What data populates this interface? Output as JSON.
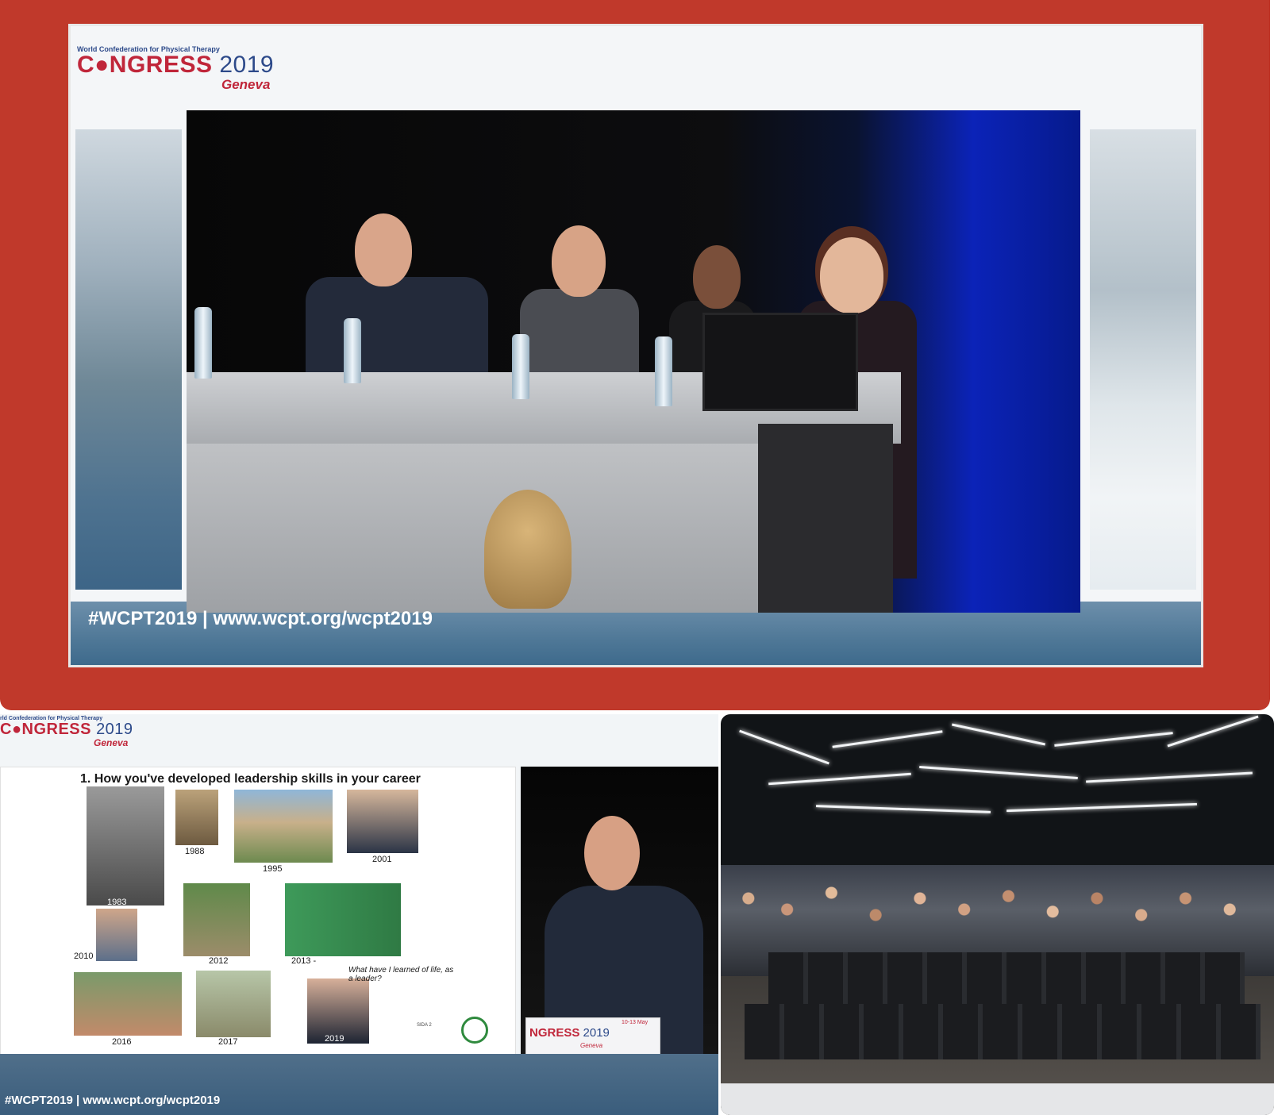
{
  "top_screen": {
    "logo": {
      "org": "World Confederation for Physical Therapy",
      "title": "C●NGRESS",
      "year": "2019",
      "city": "Geneva"
    },
    "hashtag": "#WCPT2019 | www.wcpt.org/wcpt2019"
  },
  "bottom_left": {
    "logo": {
      "org": "rld Confederation for Physical Therapy",
      "title": "C●NGRESS",
      "year": "2019",
      "city": "Geneva"
    },
    "slide": {
      "title": "1. How you've developed leadership skills in your career",
      "years": [
        "1983",
        "1988",
        "1995",
        "2001",
        "2010",
        "2012",
        "2013 -",
        "2016",
        "2017",
        "2019"
      ],
      "quote": "What have I learned of life, as a leader?",
      "page_label": "SIDA 2"
    },
    "lectern": {
      "title": "NGRESS",
      "year": "2019",
      "city": "Geneva",
      "dates": "10-13 May"
    },
    "hashtag": "#WCPT2019 | www.wcpt.org/wcpt2019"
  },
  "colors": {
    "frame": "#c0392b",
    "logo_red": "#c0263a",
    "logo_blue": "#2d4a8a",
    "stage_blue": "#0b23b8"
  }
}
